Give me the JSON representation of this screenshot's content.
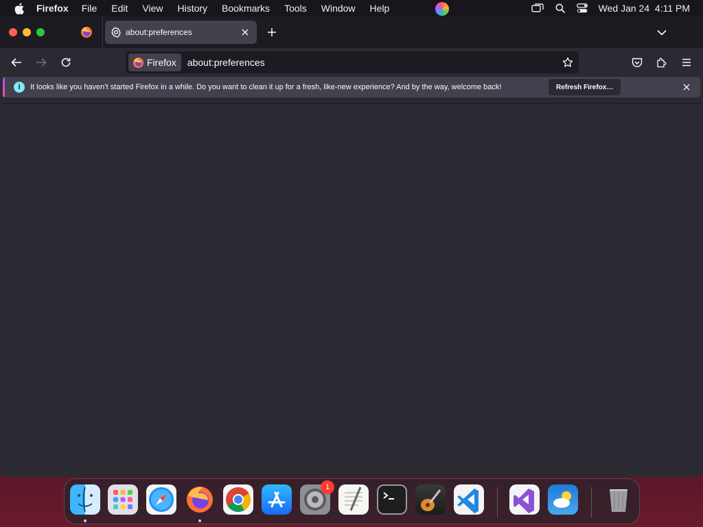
{
  "menubar": {
    "app_name": "Firefox",
    "items": [
      "File",
      "Edit",
      "View",
      "History",
      "Bookmarks",
      "Tools",
      "Window",
      "Help"
    ],
    "clock": "Wed Jan 24  4:11 PM"
  },
  "tabs": {
    "active_title": "about:preferences"
  },
  "urlbar": {
    "identity_label": "Firefox",
    "url": "about:preferences"
  },
  "notification": {
    "message": "It looks like you haven’t started Firefox in a while. Do you want to clean it up for a fresh, like-new experience? And by the way, welcome back!",
    "button_label": "Refresh Firefox…"
  },
  "dock": {
    "settings_badge": "1",
    "apps": [
      "finder",
      "launchpad",
      "safari",
      "firefox",
      "chrome",
      "app-store",
      "system-settings",
      "textedit",
      "terminal",
      "garageband",
      "vscode",
      "visual-studio",
      "weather",
      "trash"
    ]
  }
}
